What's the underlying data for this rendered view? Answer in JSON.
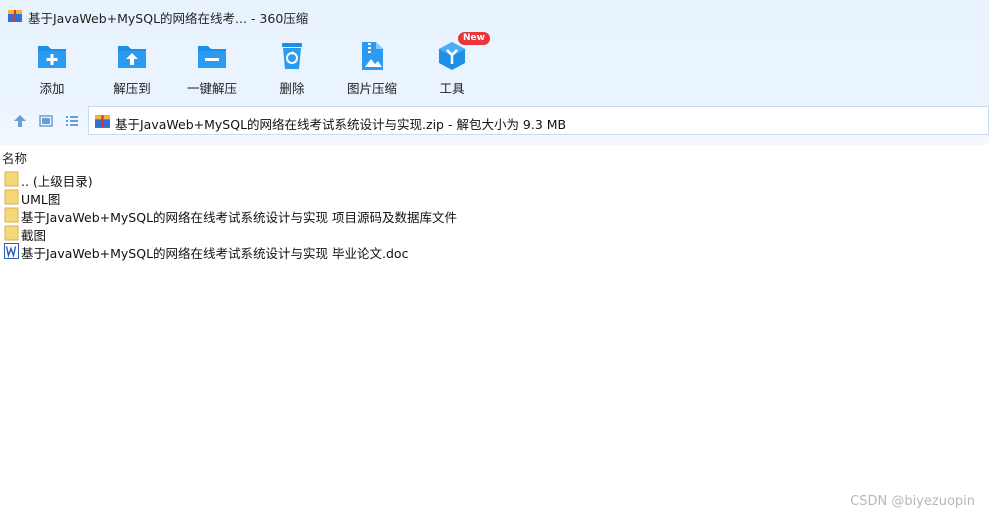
{
  "titlebar": {
    "title": "基于JavaWeb+MySQL的网络在线考... - 360压缩"
  },
  "toolbar": {
    "add": "添加",
    "extract_to": "解压到",
    "one_click_extract": "一键解压",
    "delete": "删除",
    "image_compress": "图片压缩",
    "tools": "工具",
    "tools_badge": "New"
  },
  "addressbar": {
    "path": "基于JavaWeb+MySQL的网络在线考试系统设计与实现.zip - 解包大小为 9.3 MB"
  },
  "list": {
    "column_name": "名称",
    "items": [
      {
        "name": ".. (上级目录)",
        "icon": "folder-icon"
      },
      {
        "name": "UML图",
        "icon": "folder-icon"
      },
      {
        "name": "基于JavaWeb+MySQL的网络在线考试系统设计与实现 项目源码及数据库文件",
        "icon": "folder-icon"
      },
      {
        "name": "截图",
        "icon": "folder-icon"
      },
      {
        "name": "基于JavaWeb+MySQL的网络在线考试系统设计与实现 毕业论文.doc",
        "icon": "word-doc-icon"
      }
    ]
  },
  "watermark": "CSDN @biyezuopin",
  "colors": {
    "toolbar_bg": "#eaf4fe",
    "icon_blue": "#1e8fe6",
    "folder": "#f6d77a",
    "badge": "#e8363a"
  }
}
